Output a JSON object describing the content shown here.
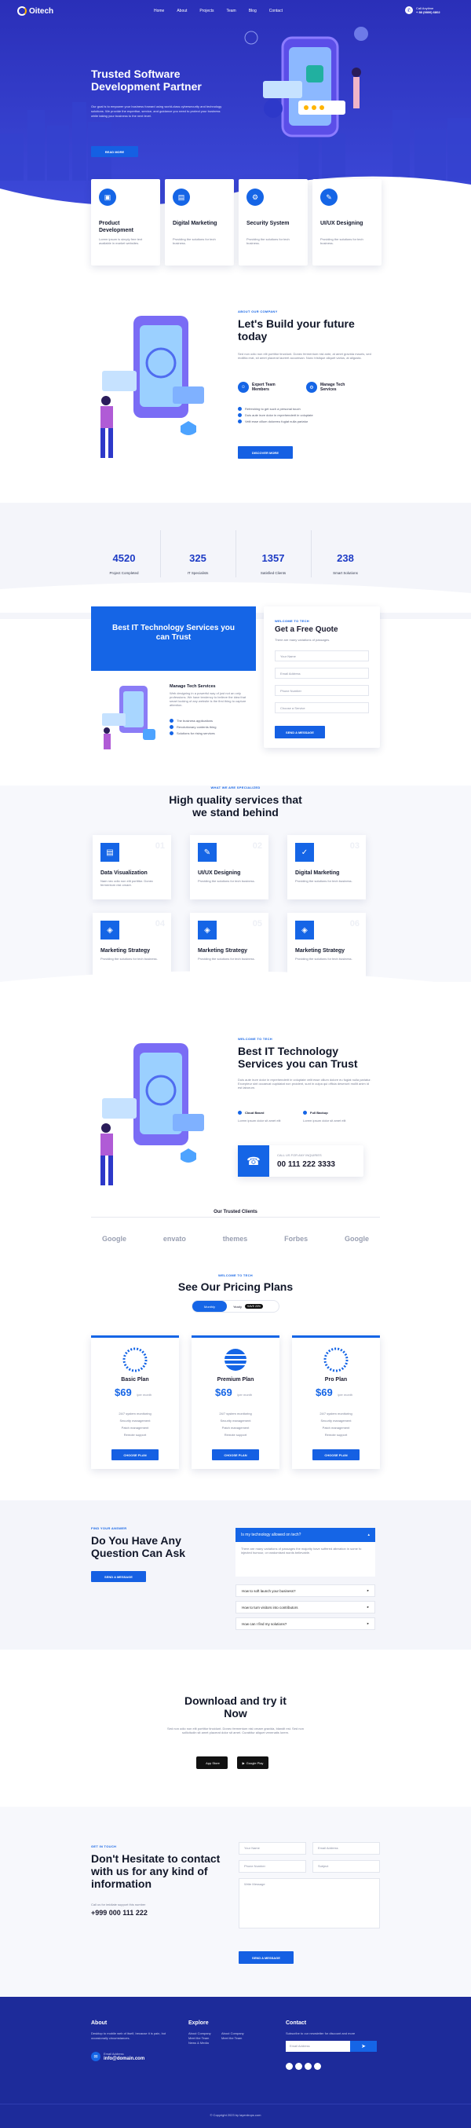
{
  "nav": {
    "logo": "Oitech",
    "menu": [
      "Home",
      "About",
      "Projects",
      "Team",
      "Blog",
      "Contact"
    ],
    "phone_label": "Call Anytime",
    "phone": "+ 88 (9800) 6802"
  },
  "hero": {
    "title": "Trusted Software Development Partner",
    "text": "Our goal is to empower your business forward using world-class cybersecurity and technology solutions. We provide the expertise, service, and guidance you need to protect your business while taking your business to the next level.",
    "button": "READ MORE"
  },
  "features": [
    {
      "title": "Product Development",
      "text": "Lorem ipsum is simply free text available in market websites."
    },
    {
      "title": "Digital Marketing",
      "text": "Providing the solutions for tech business."
    },
    {
      "title": "Security System",
      "text": "Providing the solutions for tech business."
    },
    {
      "title": "UI/UX Designing",
      "text": "Providing the solutions for tech business."
    }
  ],
  "about": {
    "kicker": "ABOUT OUR COMPANY",
    "title": "Let's Build your future today",
    "text": "Sed non odio non elit porttitor tincidunt. Donec fermentum nisl ante, at amet gravida mauris, sed mollitia erat, sit amet placerat laoreet accumsan. Nunc tristique aliquet varius, at aligusta.",
    "feature_a": "Expert Team Members",
    "feature_b": "Manage Tech Services",
    "checks": [
      "Refreshing to get such a personal touch",
      "Duis aute irure dolor in reprehenderit in voluptate",
      "Velit esse cillum doloreeu fugiat nulla pariatur"
    ],
    "button": "DISCOVER MORE"
  },
  "stats": [
    {
      "value": "4520",
      "label": "Project Completed"
    },
    {
      "value": "325",
      "label": "IT Specialists"
    },
    {
      "value": "1357",
      "label": "Satisfied Clients"
    },
    {
      "value": "238",
      "label": "Smart Solutions"
    }
  ],
  "trust": {
    "banner": "Best IT Technology Services you can Trust",
    "sub_title": "Manage Tech Services",
    "sub_text": "Web designing in a powerful way of just not an only professions. We have tendency to believe the idea that smart looking of any website is the first thing to capture attention.",
    "checks": [
      "The business applications",
      "Revolutionary contents thing",
      "Solutions for rising services"
    ]
  },
  "quote": {
    "kicker": "WELCOME TO TECH",
    "title": "Get a Free Quote",
    "text": "There are many variations of passages.",
    "fields": [
      "Your Name",
      "Email Address",
      "Phone Number",
      "Choose a Service"
    ],
    "button": "SEND A MESSAGE"
  },
  "services": {
    "kicker": "WHAT WE ARE SPECIALIZED",
    "title": "High quality services that we stand behind",
    "items": [
      {
        "title": "Data Visualization",
        "text": "Nam nec odio non elit porttitor. Donec fermentum nisl ornare.",
        "num": "01"
      },
      {
        "title": "UI/UX Designing",
        "text": "Providing the solutions for tech business.",
        "num": "02"
      },
      {
        "title": "Digital Marketing",
        "text": "Providing the solutions for tech business.",
        "num": "03"
      },
      {
        "title": "Marketing Strategy",
        "text": "Providing the solutions for tech business.",
        "num": "04"
      },
      {
        "title": "Marketing Strategy",
        "text": "Providing the solutions for tech business.",
        "num": "05"
      },
      {
        "title": "Marketing Strategy",
        "text": "Providing the solutions for tech business.",
        "num": "06"
      }
    ]
  },
  "trust2": {
    "kicker": "WELCOME TO TECH",
    "title": "Best IT Technology Services you can Trust",
    "text": "Duis aute irure dolor in reprehenderit in voluptate velit esse cillum dolore eu fugiat nulla pariatur. Excepteur sint occaecat cupidatat non proident, sunt in culpa qui officia deserunt mollit anim id est laborum.",
    "check_a": "Cloud Based",
    "check_b": "Full Backup",
    "text_a": "Lorem ipsum dolor sit amet elit",
    "text_b": "Lorem ipsum dolor sit amet elit",
    "call_label": "CALL US FOR ANY INQUIRIES",
    "call_number": "00 111 222 3333"
  },
  "clients": {
    "title": "Our Trusted Clients",
    "logos": [
      "Google",
      "envato",
      "themes",
      "Forbes",
      "Google"
    ]
  },
  "pricing": {
    "kicker": "WELCOME TO TECH",
    "title": "See Our Pricing Plans",
    "toggle_monthly": "Monthly",
    "toggle_yearly": "Yearly",
    "toggle_badge": "SAVE 20%",
    "plans": [
      {
        "name": "Basic Plan",
        "price": "$69",
        "per": "/per month",
        "features": [
          "24/7 system monitoring",
          "Security management",
          "Patch management",
          "Remote support"
        ],
        "button": "CHOOSE PLAN"
      },
      {
        "name": "Premium Plan",
        "price": "$69",
        "per": "/per month",
        "features": [
          "24/7 system monitoring",
          "Security management",
          "Patch management",
          "Remote support"
        ],
        "button": "CHOOSE PLAN"
      },
      {
        "name": "Pro Plan",
        "price": "$69",
        "per": "/per month",
        "features": [
          "24/7 system monitoring",
          "Security management",
          "Patch management",
          "Remote support"
        ],
        "button": "CHOOSE PLAN"
      }
    ]
  },
  "faq": {
    "kicker": "FIND YOUR ANSWER",
    "title": "Do You Have Any Question Can Ask",
    "button": "SEND A MESSAGE",
    "open_q": "Is my technology allowed on tech?",
    "open_a": "There are many variations of passages the majority have suffered alteration in some fo injected humour, or randomised words believable.",
    "items": [
      "How to soft launch your business?",
      "How to turn visitors into contributors",
      "How can I find my solutions?"
    ]
  },
  "app": {
    "title": "Download and try it Now",
    "text": "Sed non odio non elit porttitor tincidunt. Donec fermentum nisl ornare gravida, blandit est. Sed non sollicitudin sit amet placerat dolor sit amet. Curabitur aliquet venenatis lorem.",
    "appstore": "App Store",
    "googleplay": "Google Play"
  },
  "contact": {
    "kicker": "GET IN TOUCH",
    "title": "Don't Hesitate to contact with us for any kind of information",
    "call_label": "Call us for imidiate support this number",
    "phone": "+999 000 111 222",
    "fields": [
      "Your Name",
      "Email Address",
      "Phone Number",
      "Subject",
      "Write Message"
    ],
    "button": "SEND A MESSAGE"
  },
  "footer": {
    "about_title": "About",
    "about_text": "Desktop to mobile web of itself, because it is pain, but occasionally circumstances.",
    "email_label": "Email Address",
    "email": "info@domain.com",
    "explore_title": "Explore",
    "explore_a": [
      "About Company",
      "Meet the Team",
      "News & Media"
    ],
    "explore_b": [
      "About Company",
      "Meet the Team"
    ],
    "contact_title": "Contact",
    "contact_text": "Subscribe to our newsletter for discount and more",
    "email_placeholder": "Email Address",
    "copyright": "© Copyright 2023 by layerdrops.com"
  },
  "colors": {
    "primary": "#1565e6",
    "hero": "#2d38c9",
    "footer": "#1d2b9a"
  }
}
